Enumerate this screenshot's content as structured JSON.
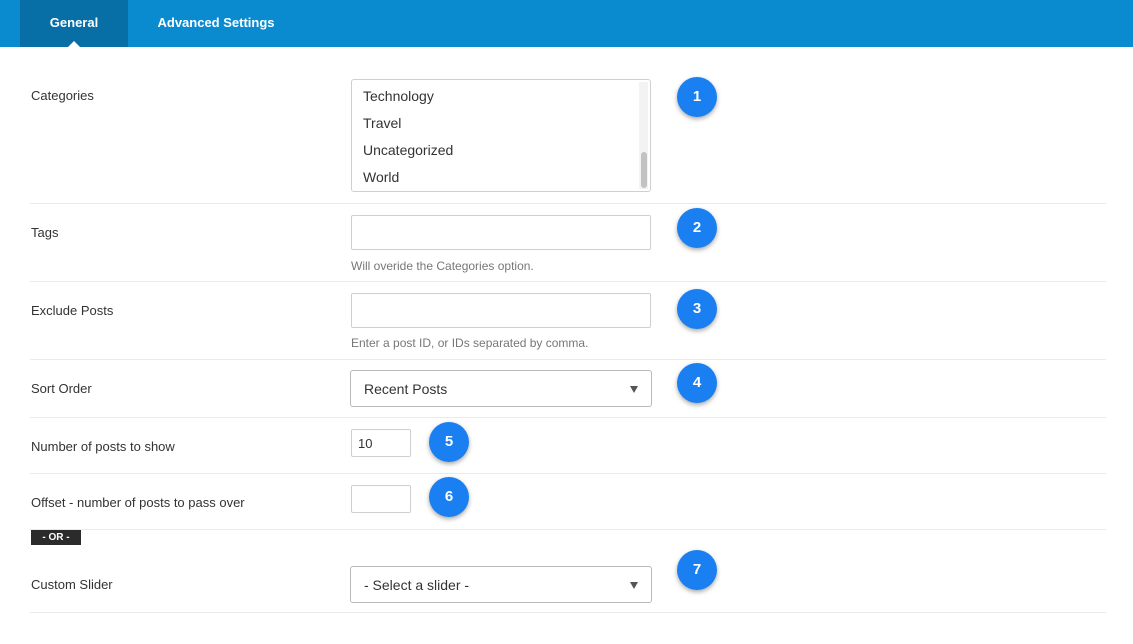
{
  "tabs": [
    {
      "label": "General",
      "active": true
    },
    {
      "label": "Advanced Settings",
      "active": false
    }
  ],
  "fields": {
    "categories": {
      "label": "Categories",
      "options": [
        "Technology",
        "Travel",
        "Uncategorized",
        "World"
      ],
      "badge": "1"
    },
    "tags": {
      "label": "Tags",
      "value": "",
      "description": "Will overide the Categories option.",
      "badge": "2"
    },
    "exclude_posts": {
      "label": "Exclude Posts",
      "value": "",
      "description": "Enter a post ID, or IDs separated by comma.",
      "badge": "3"
    },
    "sort_order": {
      "label": "Sort Order",
      "selected": "Recent Posts",
      "badge": "4"
    },
    "num_posts": {
      "label": "Number of posts to show",
      "value": "10",
      "badge": "5"
    },
    "offset": {
      "label": "Offset - number of posts to pass over",
      "value": "",
      "badge": "6"
    },
    "or_separator": "- OR -",
    "custom_slider": {
      "label": "Custom Slider",
      "selected": "- Select a slider -",
      "badge": "7"
    }
  },
  "colors": {
    "topbar": "#0a8bd0",
    "active_tab": "#086fa6",
    "badge": "#1a7ff0"
  },
  "icons": {
    "select_arrow": "caret-down-icon"
  }
}
